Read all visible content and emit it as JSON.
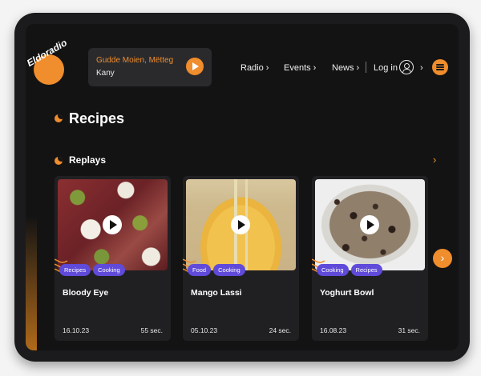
{
  "header": {
    "logo_text": "Eldoradio",
    "player": {
      "title": "Gudde Moien, Mëtteg",
      "subtitle": "Kany"
    },
    "nav": [
      {
        "label": "Radio",
        "chevron": "›"
      },
      {
        "label": "Events",
        "chevron": "›"
      },
      {
        "label": "News",
        "chevron": "›"
      }
    ],
    "login": {
      "label": "Log in",
      "chevron": "›"
    }
  },
  "page": {
    "title": "Recipes"
  },
  "section": {
    "title": "Replays",
    "chevron": "›"
  },
  "cards": [
    {
      "title": "Bloody Eye",
      "tags": [
        "Recipes",
        "Cooking"
      ],
      "date": "16.10.23",
      "duration": "55 sec."
    },
    {
      "title": "Mango Lassi",
      "tags": [
        "Food",
        "Cooking"
      ],
      "date": "05.10.23",
      "duration": "24 sec."
    },
    {
      "title": "Yoghurt Bowl",
      "tags": [
        "Cooking",
        "Recipes"
      ],
      "date": "16.08.23",
      "duration": "31 sec."
    }
  ],
  "carousel": {
    "next_label": "›"
  },
  "colors": {
    "accent": "#f08d2c",
    "tag": "#5f4ad9",
    "background": "#131314",
    "card": "#202022"
  }
}
